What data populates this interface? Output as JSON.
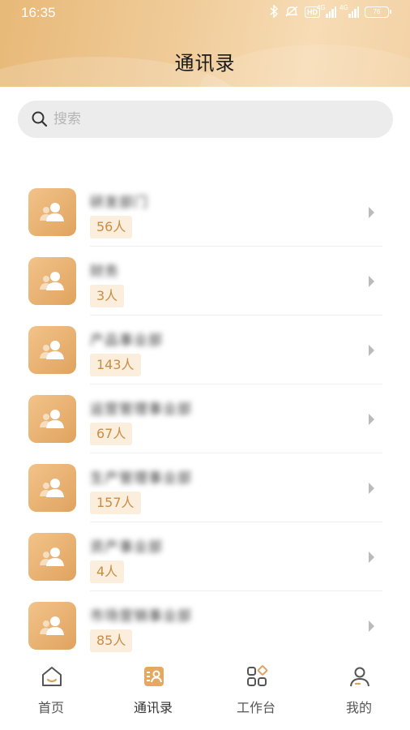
{
  "status_bar": {
    "time": "16:35",
    "hd": "HD",
    "network1": "4G",
    "network2": "4G",
    "battery": "76"
  },
  "header": {
    "title": "通讯录"
  },
  "search": {
    "placeholder": "搜索"
  },
  "departments": [
    {
      "name": "研发部门",
      "count": "56人"
    },
    {
      "name": "财务",
      "count": "3人"
    },
    {
      "name": "产品事业部",
      "count": "143人"
    },
    {
      "name": "运营管理事业部",
      "count": "67人"
    },
    {
      "name": "生产管理事业部",
      "count": "157人"
    },
    {
      "name": "资产事业部",
      "count": "4人"
    },
    {
      "name": "市场营销事业部",
      "count": "85人"
    }
  ],
  "tabs": [
    {
      "label": "首页",
      "icon": "home-icon"
    },
    {
      "label": "通讯录",
      "icon": "contacts-icon"
    },
    {
      "label": "工作台",
      "icon": "workbench-icon"
    },
    {
      "label": "我的",
      "icon": "profile-icon"
    }
  ],
  "colors": {
    "accent": "#e0a35e",
    "badge_bg": "#fbeedd",
    "badge_text": "#c98d45"
  }
}
